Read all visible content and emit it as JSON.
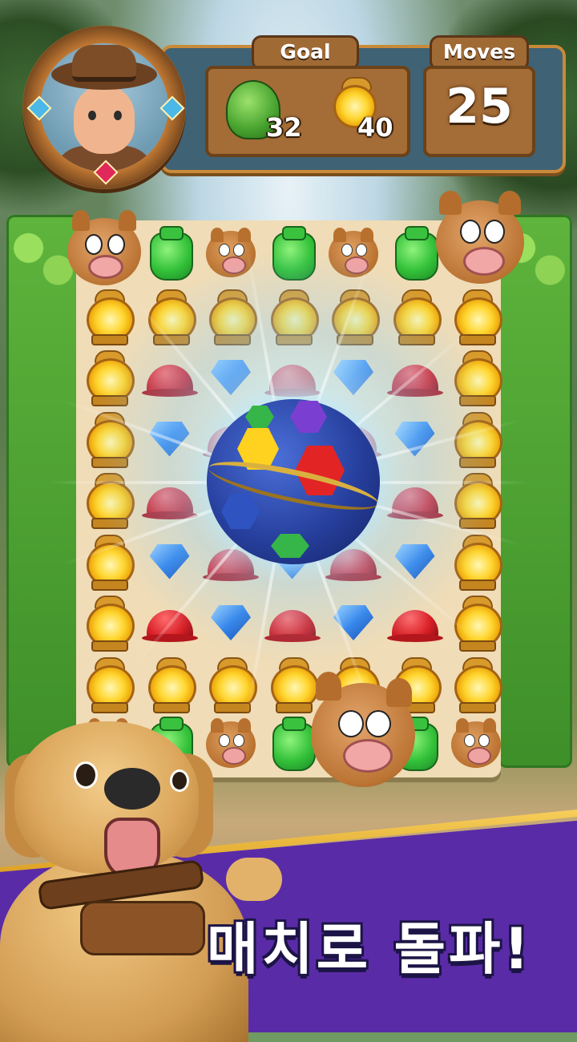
{
  "hud": {
    "goal_label": "Goal",
    "moves_label": "Moves",
    "moves_value": "25",
    "goals": [
      {
        "icon": "leaf-bush-icon",
        "count": "32"
      },
      {
        "icon": "golden-lantern-icon",
        "count": "40"
      }
    ]
  },
  "board": {
    "rows": [
      [
        "pig",
        "jar",
        "pig",
        "jar",
        "pig",
        "jar",
        "pig"
      ],
      [
        "lantern",
        "lantern",
        "lantern",
        "lantern",
        "lantern",
        "lantern",
        "lantern"
      ],
      [
        "lantern",
        "helmet",
        "diamond",
        "helmet",
        "diamond",
        "helmet",
        "lantern"
      ],
      [
        "lantern",
        "diamond",
        "helmet",
        "diamond",
        "helmet",
        "diamond",
        "lantern"
      ],
      [
        "lantern",
        "helmet",
        "diamond",
        "helmet",
        "diamond",
        "helmet",
        "lantern"
      ],
      [
        "lantern",
        "diamond",
        "helmet",
        "diamond",
        "helmet",
        "diamond",
        "lantern"
      ],
      [
        "lantern",
        "helmet",
        "diamond",
        "helmet",
        "diamond",
        "helmet",
        "lantern"
      ],
      [
        "lantern",
        "lantern",
        "lantern",
        "lantern",
        "lantern",
        "lantern",
        "lantern"
      ],
      [
        "pig",
        "jar",
        "pig",
        "jar",
        "pig",
        "jar",
        "pig"
      ]
    ]
  },
  "colors": {
    "banner": "#5a2ba7",
    "hud": "#3f6275",
    "wood": "#a46c36"
  },
  "headline": "매치로 돌파!"
}
